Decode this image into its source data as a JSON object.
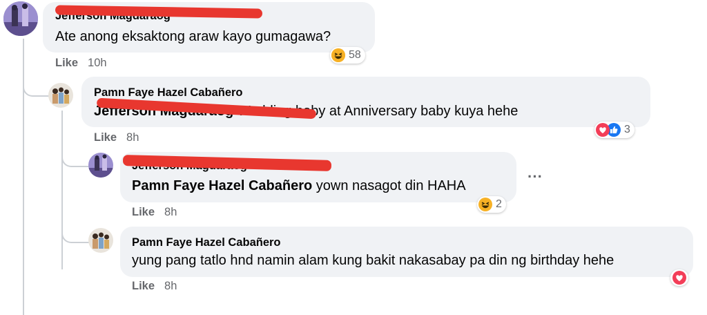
{
  "comments": [
    {
      "author": "Jefferson Magdaraog",
      "text": "Ate anong eksaktong araw kayo gumagawa?",
      "like": "Like",
      "time": "10h",
      "reaction_count": "58",
      "reaction_icons": [
        "haha-icon"
      ]
    },
    {
      "author": "Pamn Faye Hazel Cabañero",
      "mention": "Jefferson Magdaraog",
      "text": " Wedding baby at Anniversary baby kuya hehe",
      "like": "Like",
      "time": "8h",
      "reaction_count": "3",
      "reaction_icons": [
        "love-icon",
        "like-icon"
      ]
    },
    {
      "author": "Jefferson Magdaraog",
      "mention": "Pamn Faye Hazel Cabañero",
      "text": " yown nasagot din HAHA",
      "like": "Like",
      "time": "8h",
      "reaction_count": "2",
      "reaction_icons": [
        "haha-icon"
      ],
      "more_label": "···"
    },
    {
      "author": "Pamn Faye Hazel Cabañero",
      "text": "yung pang tatlo hnd namin alam kung bakit nakasabay pa din ng birthday hehe",
      "like": "Like",
      "time": "8h",
      "reaction_icons": [
        "love-icon"
      ]
    }
  ],
  "colors": {
    "bubble": "#f0f2f5",
    "meta_text": "#65676b",
    "redaction": "#e8372f",
    "love": "#f33e58",
    "like": "#1877f2",
    "haha": "#f7b125"
  }
}
